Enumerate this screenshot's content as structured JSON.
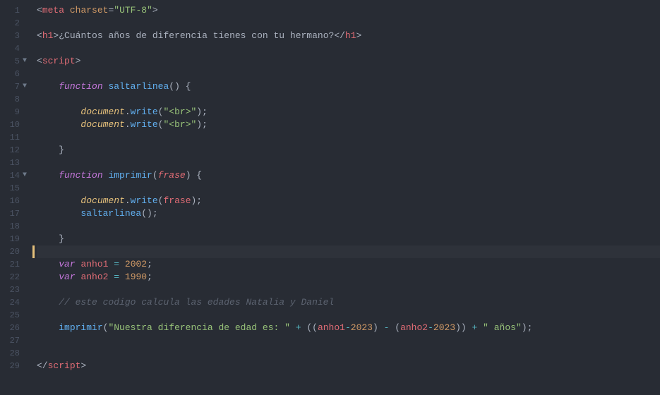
{
  "lines": [
    {
      "num": "1",
      "fold": "",
      "tokens": [
        [
          "tag-bracket",
          "<"
        ],
        [
          "tag-name",
          "meta"
        ],
        [
          "text",
          " "
        ],
        [
          "attr-name",
          "charset"
        ],
        [
          "attr-eq",
          "="
        ],
        [
          "string",
          "\"UTF-8\""
        ],
        [
          "tag-bracket",
          ">"
        ]
      ]
    },
    {
      "num": "2",
      "fold": "",
      "tokens": []
    },
    {
      "num": "3",
      "fold": "",
      "tokens": [
        [
          "tag-bracket",
          "<"
        ],
        [
          "tag-name",
          "h1"
        ],
        [
          "tag-bracket",
          ">"
        ],
        [
          "text",
          "¿Cuántos años de diferencia tienes con tu hermano?"
        ],
        [
          "tag-bracket",
          "</"
        ],
        [
          "tag-name",
          "h1"
        ],
        [
          "tag-bracket",
          ">"
        ]
      ]
    },
    {
      "num": "4",
      "fold": "",
      "tokens": []
    },
    {
      "num": "5",
      "fold": "▼",
      "tokens": [
        [
          "tag-bracket",
          "<"
        ],
        [
          "tag-name",
          "script"
        ],
        [
          "tag-bracket",
          ">"
        ]
      ]
    },
    {
      "num": "6",
      "fold": "",
      "tokens": []
    },
    {
      "num": "7",
      "fold": "▼",
      "tokens": [
        [
          "text",
          "    "
        ],
        [
          "keyword",
          "function"
        ],
        [
          "text",
          " "
        ],
        [
          "func-name",
          "saltarlinea"
        ],
        [
          "punct",
          "() {"
        ]
      ]
    },
    {
      "num": "8",
      "fold": "",
      "tokens": []
    },
    {
      "num": "9",
      "fold": "",
      "tokens": [
        [
          "text",
          "        "
        ],
        [
          "obj",
          "document"
        ],
        [
          "punct",
          "."
        ],
        [
          "method",
          "write"
        ],
        [
          "punct",
          "("
        ],
        [
          "string",
          "\"<br>\""
        ],
        [
          "punct",
          ");"
        ]
      ]
    },
    {
      "num": "10",
      "fold": "",
      "tokens": [
        [
          "text",
          "        "
        ],
        [
          "obj",
          "document"
        ],
        [
          "punct",
          "."
        ],
        [
          "method",
          "write"
        ],
        [
          "punct",
          "("
        ],
        [
          "string",
          "\"<br>\""
        ],
        [
          "punct",
          ");"
        ]
      ]
    },
    {
      "num": "11",
      "fold": "",
      "tokens": []
    },
    {
      "num": "12",
      "fold": "",
      "tokens": [
        [
          "text",
          "    "
        ],
        [
          "punct",
          "}"
        ]
      ]
    },
    {
      "num": "13",
      "fold": "",
      "tokens": []
    },
    {
      "num": "14",
      "fold": "▼",
      "tokens": [
        [
          "text",
          "    "
        ],
        [
          "keyword",
          "function"
        ],
        [
          "text",
          " "
        ],
        [
          "func-name",
          "imprimir"
        ],
        [
          "punct",
          "("
        ],
        [
          "param",
          "frase"
        ],
        [
          "punct",
          ") {"
        ]
      ]
    },
    {
      "num": "15",
      "fold": "",
      "tokens": []
    },
    {
      "num": "16",
      "fold": "",
      "tokens": [
        [
          "text",
          "        "
        ],
        [
          "obj",
          "document"
        ],
        [
          "punct",
          "."
        ],
        [
          "method",
          "write"
        ],
        [
          "punct",
          "("
        ],
        [
          "var-use",
          "frase"
        ],
        [
          "punct",
          ");"
        ]
      ]
    },
    {
      "num": "17",
      "fold": "",
      "tokens": [
        [
          "text",
          "        "
        ],
        [
          "func-call",
          "saltarlinea"
        ],
        [
          "punct",
          "();"
        ]
      ]
    },
    {
      "num": "18",
      "fold": "",
      "tokens": []
    },
    {
      "num": "19",
      "fold": "",
      "tokens": [
        [
          "text",
          "    "
        ],
        [
          "punct",
          "}"
        ]
      ]
    },
    {
      "num": "20",
      "fold": "",
      "tokens": [],
      "active": true
    },
    {
      "num": "21",
      "fold": "",
      "tokens": [
        [
          "text",
          "    "
        ],
        [
          "keyword",
          "var"
        ],
        [
          "text",
          " "
        ],
        [
          "var-use",
          "anho1"
        ],
        [
          "text",
          " "
        ],
        [
          "op",
          "="
        ],
        [
          "text",
          " "
        ],
        [
          "number",
          "2002"
        ],
        [
          "punct",
          ";"
        ]
      ]
    },
    {
      "num": "22",
      "fold": "",
      "tokens": [
        [
          "text",
          "    "
        ],
        [
          "keyword",
          "var"
        ],
        [
          "text",
          " "
        ],
        [
          "var-use",
          "anho2"
        ],
        [
          "text",
          " "
        ],
        [
          "op",
          "="
        ],
        [
          "text",
          " "
        ],
        [
          "number",
          "1990"
        ],
        [
          "punct",
          ";"
        ]
      ]
    },
    {
      "num": "23",
      "fold": "",
      "tokens": []
    },
    {
      "num": "24",
      "fold": "",
      "tokens": [
        [
          "text",
          "    "
        ],
        [
          "comment",
          "// este codigo calcula las edades Natalia y Daniel"
        ]
      ]
    },
    {
      "num": "25",
      "fold": "",
      "tokens": []
    },
    {
      "num": "26",
      "fold": "",
      "tokens": [
        [
          "text",
          "    "
        ],
        [
          "func-call",
          "imprimir"
        ],
        [
          "punct",
          "("
        ],
        [
          "string",
          "\"Nuestra diferencia de edad es: \""
        ],
        [
          "text",
          " "
        ],
        [
          "op",
          "+"
        ],
        [
          "text",
          " "
        ],
        [
          "punct",
          "(("
        ],
        [
          "var-use",
          "anho1"
        ],
        [
          "op",
          "-"
        ],
        [
          "number",
          "2023"
        ],
        [
          "punct",
          ")"
        ],
        [
          "text",
          " "
        ],
        [
          "op",
          "-"
        ],
        [
          "text",
          " "
        ],
        [
          "punct",
          "("
        ],
        [
          "var-use",
          "anho2"
        ],
        [
          "op",
          "-"
        ],
        [
          "number",
          "2023"
        ],
        [
          "punct",
          "))"
        ],
        [
          "text",
          " "
        ],
        [
          "op",
          "+"
        ],
        [
          "text",
          " "
        ],
        [
          "string",
          "\" años\""
        ],
        [
          "punct",
          ");"
        ]
      ]
    },
    {
      "num": "27",
      "fold": "",
      "tokens": []
    },
    {
      "num": "28",
      "fold": "",
      "tokens": []
    },
    {
      "num": "29",
      "fold": "",
      "tokens": [
        [
          "tag-bracket",
          "</"
        ],
        [
          "tag-name",
          "script"
        ],
        [
          "tag-bracket",
          ">"
        ]
      ]
    }
  ]
}
